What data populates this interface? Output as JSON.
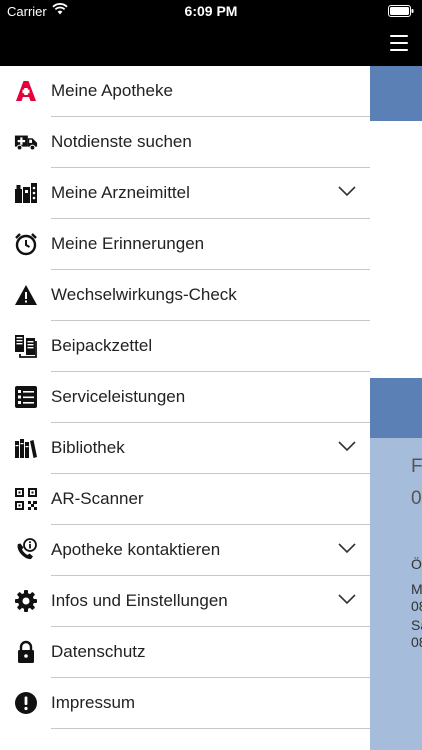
{
  "status_bar": {
    "carrier": "Carrier",
    "time": "6:09 PM"
  },
  "menu": {
    "items": [
      {
        "label": "Meine Apotheke",
        "icon": "pharmacy-icon",
        "has_chevron": false
      },
      {
        "label": "Notdienste suchen",
        "icon": "ambulance-icon",
        "has_chevron": false
      },
      {
        "label": "Meine Arzneimittel",
        "icon": "medicine-icon",
        "has_chevron": true
      },
      {
        "label": "Meine Erinnerungen",
        "icon": "alarm-clock-icon",
        "has_chevron": false
      },
      {
        "label": "Wechselwirkungs-Check",
        "icon": "warning-icon",
        "has_chevron": false
      },
      {
        "label": "Beipackzettel",
        "icon": "leaflet-icon",
        "has_chevron": false
      },
      {
        "label": "Serviceleistungen",
        "icon": "service-list-icon",
        "has_chevron": false
      },
      {
        "label": "Bibliothek",
        "icon": "library-icon",
        "has_chevron": true
      },
      {
        "label": "AR-Scanner",
        "icon": "qr-code-icon",
        "has_chevron": false
      },
      {
        "label": "Apotheke kontaktieren",
        "icon": "phone-info-icon",
        "has_chevron": true
      },
      {
        "label": "Infos und Einstellungen",
        "icon": "gear-icon",
        "has_chevron": true
      },
      {
        "label": "Datenschutz",
        "icon": "lock-icon",
        "has_chevron": false
      },
      {
        "label": "Impressum",
        "icon": "exclamation-icon",
        "has_chevron": false
      }
    ]
  },
  "background_fragments": [
    "F",
    "0",
    "Ö",
    "M",
    "08",
    "Sa",
    "08"
  ],
  "colors": {
    "accent_red": "#e4003a",
    "header_blue": "#5b80b5",
    "panel_blue": "#a5bcdb"
  }
}
